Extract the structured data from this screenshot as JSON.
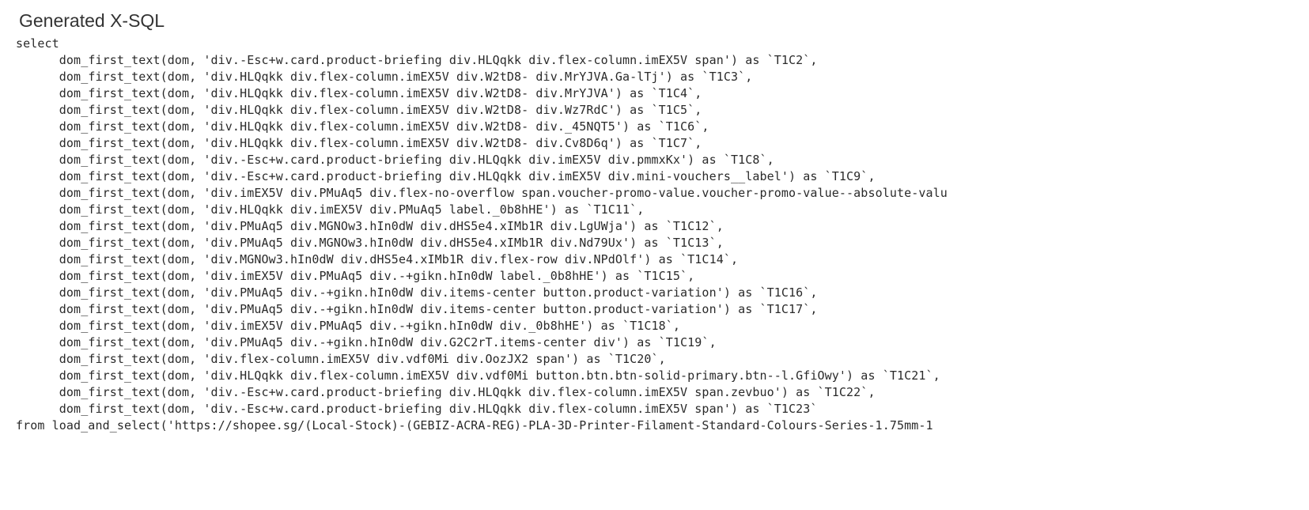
{
  "heading": "Generated X-SQL",
  "sql": {
    "keyword_select": "select",
    "lines": [
      "dom_first_text(dom, 'div.-Esc+w.card.product-briefing div.HLQqkk div.flex-column.imEX5V span') as `T1C2`,",
      "dom_first_text(dom, 'div.HLQqkk div.flex-column.imEX5V div.W2tD8- div.MrYJVA.Ga-lTj') as `T1C3`,",
      "dom_first_text(dom, 'div.HLQqkk div.flex-column.imEX5V div.W2tD8- div.MrYJVA') as `T1C4`,",
      "dom_first_text(dom, 'div.HLQqkk div.flex-column.imEX5V div.W2tD8- div.Wz7RdC') as `T1C5`,",
      "dom_first_text(dom, 'div.HLQqkk div.flex-column.imEX5V div.W2tD8- div._45NQT5') as `T1C6`,",
      "dom_first_text(dom, 'div.HLQqkk div.flex-column.imEX5V div.W2tD8- div.Cv8D6q') as `T1C7`,",
      "dom_first_text(dom, 'div.-Esc+w.card.product-briefing div.HLQqkk div.imEX5V div.pmmxKx') as `T1C8`,",
      "dom_first_text(dom, 'div.-Esc+w.card.product-briefing div.HLQqkk div.imEX5V div.mini-vouchers__label') as `T1C9`,",
      "dom_first_text(dom, 'div.imEX5V div.PMuAq5 div.flex-no-overflow span.voucher-promo-value.voucher-promo-value--absolute-valu",
      "dom_first_text(dom, 'div.HLQqkk div.imEX5V div.PMuAq5 label._0b8hHE') as `T1C11`,",
      "dom_first_text(dom, 'div.PMuAq5 div.MGNOw3.hIn0dW div.dHS5e4.xIMb1R div.LgUWja') as `T1C12`,",
      "dom_first_text(dom, 'div.PMuAq5 div.MGNOw3.hIn0dW div.dHS5e4.xIMb1R div.Nd79Ux') as `T1C13`,",
      "dom_first_text(dom, 'div.MGNOw3.hIn0dW div.dHS5e4.xIMb1R div.flex-row div.NPdOlf') as `T1C14`,",
      "dom_first_text(dom, 'div.imEX5V div.PMuAq5 div.-+gikn.hIn0dW label._0b8hHE') as `T1C15`,",
      "dom_first_text(dom, 'div.PMuAq5 div.-+gikn.hIn0dW div.items-center button.product-variation') as `T1C16`,",
      "dom_first_text(dom, 'div.PMuAq5 div.-+gikn.hIn0dW div.items-center button.product-variation') as `T1C17`,",
      "dom_first_text(dom, 'div.imEX5V div.PMuAq5 div.-+gikn.hIn0dW div._0b8hHE') as `T1C18`,",
      "dom_first_text(dom, 'div.PMuAq5 div.-+gikn.hIn0dW div.G2C2rT.items-center div') as `T1C19`,",
      "dom_first_text(dom, 'div.flex-column.imEX5V div.vdf0Mi div.OozJX2 span') as `T1C20`,",
      "dom_first_text(dom, 'div.HLQqkk div.flex-column.imEX5V div.vdf0Mi button.btn.btn-solid-primary.btn--l.GfiOwy') as `T1C21`,",
      "dom_first_text(dom, 'div.-Esc+w.card.product-briefing div.HLQqkk div.flex-column.imEX5V span.zevbuo') as `T1C22`,",
      "dom_first_text(dom, 'div.-Esc+w.card.product-briefing div.HLQqkk div.flex-column.imEX5V span') as `T1C23`"
    ],
    "from_line": "from load_and_select('https://shopee.sg/(Local-Stock)-(GEBIZ-ACRA-REG)-PLA-3D-Printer-Filament-Standard-Colours-Series-1.75mm-1"
  }
}
